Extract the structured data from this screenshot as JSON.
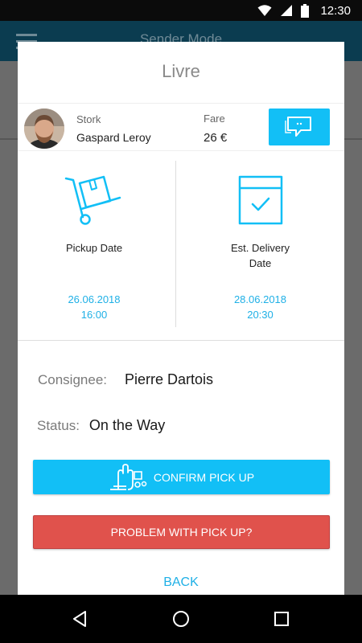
{
  "status_bar": {
    "time": "12:30",
    "icons": [
      "wifi-icon",
      "signal-icon",
      "battery-icon"
    ]
  },
  "background_app": {
    "title": "Sender Mode"
  },
  "dialog": {
    "title": "Livre",
    "courier": {
      "role": "Stork",
      "name": "Gaspard Leroy",
      "fare_label": "Fare",
      "fare_value": "26 €"
    },
    "pickup": {
      "label": "Pickup Date",
      "date": "26.06.2018",
      "time": "16:00"
    },
    "delivery": {
      "label_line1": "Est. Delivery",
      "label_line2": "Date",
      "date": "28.06.2018",
      "time": "20:30"
    },
    "consignee": {
      "label": "Consignee:",
      "value": "Pierre Dartois"
    },
    "status": {
      "label": "Status:",
      "value": "On the Way"
    },
    "confirm_button": "CONFIRM PICK UP",
    "problem_button": "PROBLEM WITH PICK UP?",
    "back_link": "BACK"
  },
  "colors": {
    "accent": "#12bff6",
    "danger": "#e0524c",
    "link": "#1fb0e6"
  }
}
